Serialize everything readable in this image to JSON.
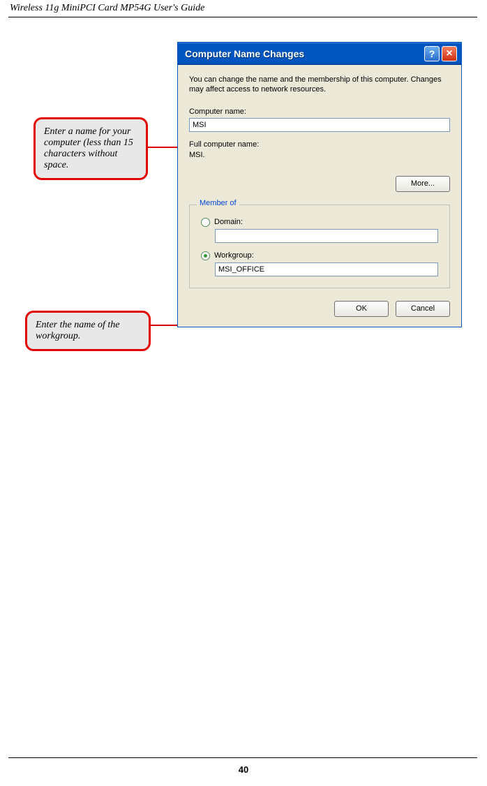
{
  "doc": {
    "header": "Wireless 11g MiniPCI Card MP54G User's Guide",
    "page_number": "40"
  },
  "callouts": {
    "computer_name": "Enter a name for your computer (less than 15 characters without space.",
    "workgroup": "Enter the name of the workgroup."
  },
  "dialog": {
    "title": "Computer Name Changes",
    "info": "You can change the name and the membership of this computer. Changes may affect access to network resources.",
    "computer_name_label": "Computer name:",
    "computer_name_value": "MSI",
    "full_name_label": "Full computer name:",
    "full_name_value": "MSI.",
    "more_button": "More...",
    "member_of_legend": "Member of",
    "domain_label": "Domain:",
    "domain_value": "",
    "workgroup_label": "Workgroup:",
    "workgroup_value": "MSI_OFFICE",
    "ok_button": "OK",
    "cancel_button": "Cancel"
  }
}
